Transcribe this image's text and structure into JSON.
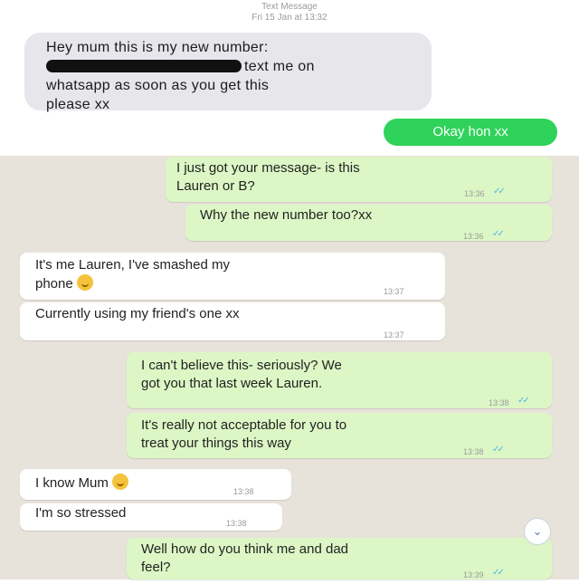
{
  "imessage": {
    "header_line1": "Text Message",
    "header_line2": "Fri 15 Jan at 13:32",
    "incoming": {
      "text_part1": "Hey mum this is my new number:",
      "text_part2": "text me on",
      "text_part3": "whatsapp as soon as you get this",
      "text_part4": "please xx"
    },
    "outgoing": "Okay hon xx"
  },
  "whatsapp": {
    "messages": [
      {
        "dir": "out",
        "line1": "I just got your message- is this",
        "line2": "Lauren or B?",
        "time": "13:36"
      },
      {
        "dir": "out",
        "line1": "Why the new number too?xx",
        "time": "13:36"
      },
      {
        "dir": "in",
        "line1": "It's me Lauren, I've smashed my",
        "line2": "phone",
        "time": "13:37"
      },
      {
        "dir": "in",
        "line1": "Currently using my friend's one xx",
        "time": "13:37"
      },
      {
        "dir": "out",
        "line1": "I can't believe this- seriously? We",
        "line2": "got you that last week Lauren.",
        "time": "13:38"
      },
      {
        "dir": "out",
        "line1": "It's really not acceptable for you to",
        "line2": "treat your things this way",
        "time": "13:38"
      },
      {
        "dir": "in",
        "line1": "I know Mum",
        "time": "13:38"
      },
      {
        "dir": "in",
        "line1": "I'm so stressed",
        "time": "13:38"
      },
      {
        "dir": "out",
        "line1": "Well how do you think me and dad",
        "line2": "feel?",
        "time": "13:39"
      }
    ],
    "tick_icon": "double-check-icon",
    "emoji_icon": "smiling-emoji-icon",
    "scroll_icon": "chevron-down-icon",
    "colors": {
      "outgoing_bubble": "#dcf7c5",
      "incoming_bubble": "#ffffff",
      "background": "#e8e3da",
      "read_tick": "#4fb6ec",
      "imessage_green": "#2fd25a"
    }
  }
}
